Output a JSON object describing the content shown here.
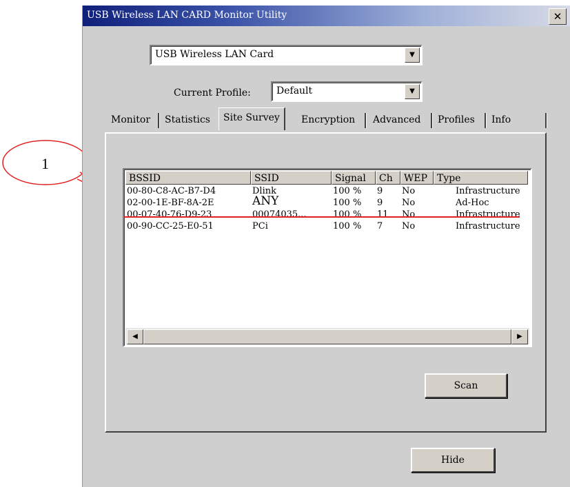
{
  "window": {
    "title": "USB Wireless LAN CARD Monitor Utility",
    "close_label": "✕"
  },
  "adapter": {
    "value": "USB Wireless LAN Card"
  },
  "profile": {
    "label": "Current Profile:",
    "value": "Default"
  },
  "tabs": [
    {
      "label": "Monitor"
    },
    {
      "label": "Statistics"
    },
    {
      "label": "Site Survey",
      "active": true
    },
    {
      "label": "Encryption"
    },
    {
      "label": "Advanced"
    },
    {
      "label": "Profiles"
    },
    {
      "label": "Info"
    }
  ],
  "list": {
    "columns": [
      "BSSID",
      "SSID",
      "Signal",
      "Ch",
      "WEP",
      "Type"
    ],
    "rows": [
      [
        "00-80-C8-AC-B7-D4",
        "Dlink",
        "100 %",
        "9",
        "No",
        "Infrastructure"
      ],
      [
        "02-00-1E-BF-8A-2E",
        "ANY",
        "100 %",
        "9",
        "No",
        "Ad-Hoc"
      ],
      [
        "00-07-40-76-D9-23",
        "00074035...",
        "100 %",
        "11",
        "No",
        "Infrastructure"
      ],
      [
        "00-90-CC-25-E0-51",
        "PCi",
        "100 %",
        "7",
        "No",
        "Infrastructure"
      ]
    ]
  },
  "buttons": {
    "scan": "Scan",
    "hide": "Hide"
  },
  "annotation": {
    "number": "1"
  },
  "colors": {
    "title_start": "#10207a",
    "annotation": "#e02020",
    "window_bg": "#cfcfcf"
  }
}
